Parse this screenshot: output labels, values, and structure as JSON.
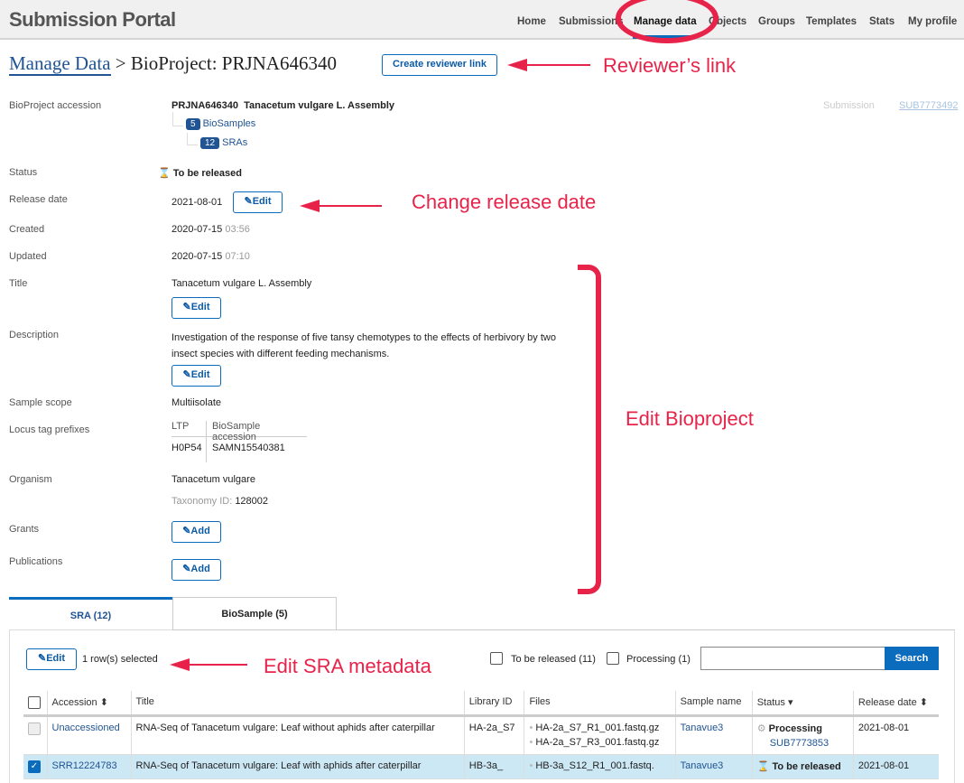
{
  "header": {
    "brand": "Submission Portal",
    "nav": [
      "Home",
      "Submissions",
      "Manage data",
      "Objects",
      "Groups",
      "Templates",
      "Stats",
      "My profile"
    ],
    "active": "Manage data"
  },
  "breadcrumb": {
    "root": "Manage Data",
    "sep": ">",
    "current": "BioProject: PRJNA646340"
  },
  "reviewer_button": "Create reviewer link",
  "annotations": {
    "reviewer": "Reviewer’s link",
    "release": "Change release date",
    "bioproject": "Edit Bioproject",
    "sra": "Edit SRA metadata"
  },
  "fields": {
    "accession_label": "BioProject accession",
    "accession": "PRJNA646340",
    "accession_title": "Tanacetum vulgare L. Assembly",
    "biosamples_count": "5",
    "biosamples_label": "BioSamples",
    "sras_count": "12",
    "sras_label": "SRAs",
    "submission_label": "Submission",
    "submission_id": "SUB7773492",
    "status_label": "Status",
    "status": "To be released",
    "release_label": "Release date",
    "release": "2021-08-01",
    "created_label": "Created",
    "created_date": "2020-07-15",
    "created_time": "03:56",
    "updated_label": "Updated",
    "updated_date": "2020-07-15",
    "updated_time": "07:10",
    "title_label": "Title",
    "title": "Tanacetum vulgare L. Assembly",
    "description_label": "Description",
    "description": "Investigation of the response of five tansy chemotypes to the effects of herbivory by two insect species with different feeding mechanisms.",
    "scope_label": "Sample scope",
    "scope": "Multiisolate",
    "locus_label": "Locus tag prefixes",
    "locus_headers": [
      "LTP",
      "BioSample accession"
    ],
    "locus_row": [
      "H0P54",
      "SAMN15540381"
    ],
    "organism_label": "Organism",
    "organism": "Tanacetum vulgare",
    "taxonomy_label": "Taxonomy ID:",
    "taxonomy": "128002",
    "grants_label": "Grants",
    "publications_label": "Publications",
    "edit": "Edit",
    "add": "Add"
  },
  "tabs": [
    "SRA (12)",
    "BioSample (5)"
  ],
  "toolbar": {
    "edit": "Edit",
    "selected": "1 row(s) selected",
    "filter1": "To be released (11)",
    "filter2": "Processing (1)",
    "search_value": "",
    "search": "Search"
  },
  "table": {
    "headers": [
      "Accession",
      "Title",
      "Library ID",
      "Files",
      "Sample name",
      "Status",
      "Release date"
    ],
    "rows": [
      {
        "accession": "Unaccessioned",
        "title": "RNA-Seq of Tanacetum vulgare: Leaf without aphids after caterpillar",
        "library": "HA-2a_S7",
        "files": [
          "HA-2a_S7_R1_001.fastq.gz",
          "HA-2a_S7_R3_001.fastq.gz"
        ],
        "sample": "Tanavue3",
        "status": "Processing",
        "sub": "SUB7773853",
        "release": "2021-08-01",
        "selected": false
      },
      {
        "accession": "SRR12224783",
        "title": "RNA-Seq of Tanacetum vulgare: Leaf with aphids after caterpillar",
        "library": "HB-3a_",
        "files": [
          "HB-3a_S12_R1_001.fastq."
        ],
        "sample": "Tanavue3",
        "status": "To be released",
        "sub": "",
        "release": "2021-08-01",
        "selected": true
      }
    ]
  },
  "colors": {
    "accent": "#0b6bbd",
    "annotation": "#e8234a",
    "selected_row": "#cde8f5"
  }
}
